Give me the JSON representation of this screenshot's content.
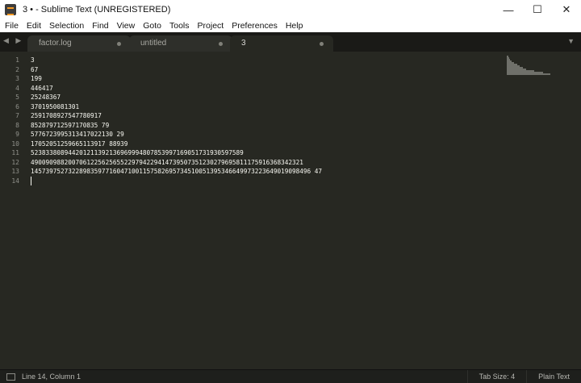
{
  "window": {
    "title": "3 • - Sublime Text (UNREGISTERED)",
    "controls": [
      "—",
      "☐",
      "✕"
    ]
  },
  "menu": [
    "File",
    "Edit",
    "Selection",
    "Find",
    "View",
    "Goto",
    "Tools",
    "Project",
    "Preferences",
    "Help"
  ],
  "tabs": [
    {
      "label": "factor.log",
      "active": false
    },
    {
      "label": "untitled",
      "active": false
    },
    {
      "label": "3",
      "active": true
    }
  ],
  "tabbar": {
    "nav_arrows": "◀ ▶",
    "dropdown": "▼"
  },
  "editor": {
    "lines": [
      "3",
      "67",
      "199",
      "446417",
      "25248367",
      "3701950081301",
      "2591708927547780917",
      "852879712597170835 79",
      "5776723995313417022130 29",
      "17052051259665113917 88939",
      "523833808944201211392136969994807853997169051731930597589",
      "4900909882007061225625655229794229414739507351230279695811175916368342321",
      "145739752732289835977160471001157582695734510051395346649973223649019098496 47",
      ""
    ],
    "line_numbers": [
      "1",
      "2",
      "3",
      "4",
      "5",
      "6",
      "7",
      "8",
      "9",
      "10",
      "11",
      "12",
      "13",
      "14"
    ]
  },
  "status": {
    "position": "Line 14, Column 1",
    "tab_size": "Tab Size: 4",
    "syntax": "Plain Text"
  },
  "colors": {
    "editor_bg": "#272822",
    "tabbar_bg": "#1a1a17",
    "text": "#f8f8f2",
    "gutter_text": "#8f908a"
  }
}
